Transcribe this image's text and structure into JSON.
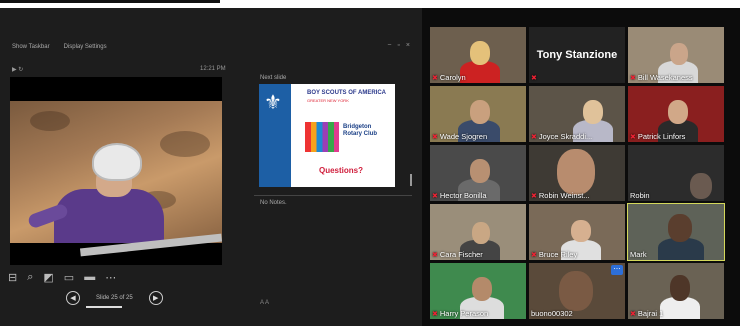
{
  "presenter": {
    "toolbar": [
      "Show Taskbar",
      "Display Settings"
    ],
    "time": "12:21 PM",
    "next_slide_label": "Next slide",
    "next_slide": {
      "title": "BOY SCOUTS OF AMERICA",
      "subtitle": "GREATER NEW YORK",
      "club": "Bridgeton Rotary Club",
      "question": "Questions?"
    },
    "notes": "No Notes.",
    "slide_counter": "Slide 25 of 25"
  },
  "participants": [
    {
      "name": "Carolyn",
      "muted": true
    },
    {
      "name": "Tony Stanzione",
      "muted": true
    },
    {
      "name": "Bill Wasekaness",
      "muted": true
    },
    {
      "name": "Wade Sjogren",
      "muted": true
    },
    {
      "name": "Joyce Skraddi...",
      "muted": true
    },
    {
      "name": "Patrick Linfors",
      "muted": true
    },
    {
      "name": "Hector Bonilla",
      "muted": true
    },
    {
      "name": "Robin Weinst...",
      "muted": true
    },
    {
      "name": "Robin",
      "muted": false
    },
    {
      "name": "Cara Fischer",
      "muted": true
    },
    {
      "name": "Bruce Riley",
      "muted": true
    },
    {
      "name": "Mark",
      "muted": false
    },
    {
      "name": "Harry Perason",
      "muted": true
    },
    {
      "name": "buono00302",
      "muted": false
    },
    {
      "name": "Bajrai 1",
      "muted": true
    }
  ],
  "colors": {
    "active_speaker": "#d4d85a",
    "muted": "#e02020"
  }
}
